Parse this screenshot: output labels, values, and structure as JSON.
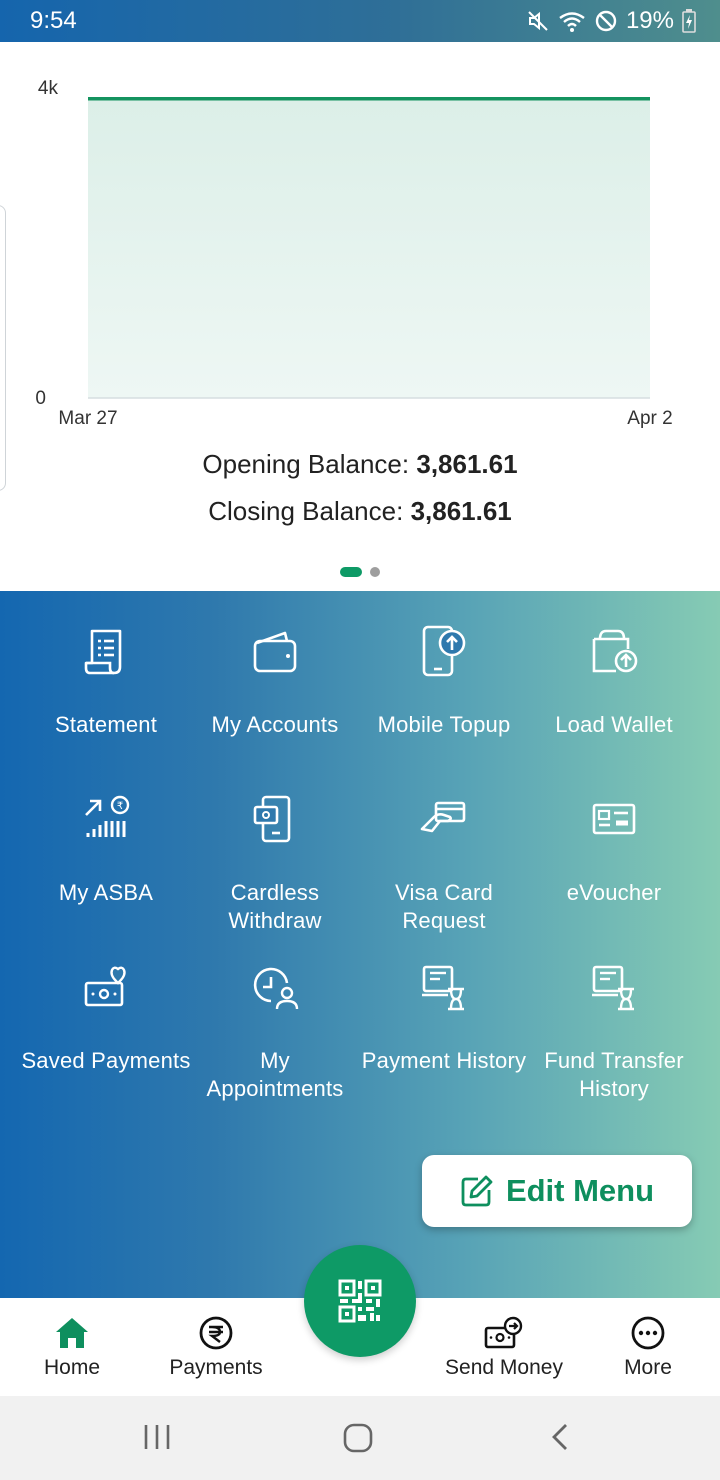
{
  "status_bar": {
    "time": "9:54",
    "battery": "19%"
  },
  "chart_data": {
    "type": "area",
    "x": [
      "Mar 27",
      "Apr 2"
    ],
    "y": [
      3861.61,
      3861.61
    ],
    "y_ticks": [
      "0",
      "4k"
    ],
    "ylim": [
      0,
      4000
    ],
    "color": "#14935f"
  },
  "balances": {
    "opening_label": "Opening Balance:",
    "opening_value": "3,861.61",
    "closing_label": "Closing Balance:",
    "closing_value": "3,861.61"
  },
  "menu": {
    "items": [
      {
        "label": "Statement",
        "icon": "statement-icon"
      },
      {
        "label": "My Accounts",
        "icon": "wallet-icon"
      },
      {
        "label": "Mobile Topup",
        "icon": "mobile-topup-icon"
      },
      {
        "label": "Load Wallet",
        "icon": "load-wallet-icon"
      },
      {
        "label": "My ASBA",
        "icon": "asba-icon"
      },
      {
        "label": "Cardless Withdraw",
        "icon": "cardless-withdraw-icon"
      },
      {
        "label": "Visa Card Request",
        "icon": "visa-card-icon"
      },
      {
        "label": "eVoucher",
        "icon": "evoucher-icon"
      },
      {
        "label": "Saved Payments",
        "icon": "saved-payments-icon"
      },
      {
        "label": "My Appointments",
        "icon": "appointment-icon"
      },
      {
        "label": "Payment History",
        "icon": "payment-history-icon"
      },
      {
        "label": "Fund Transfer History",
        "icon": "fund-transfer-history-icon"
      }
    ],
    "edit_label": "Edit Menu"
  },
  "bottom_nav": {
    "home": "Home",
    "payments": "Payments",
    "send_money": "Send Money",
    "more": "More"
  },
  "colors": {
    "brand_green": "#0e9a66",
    "gradient_start": "#1467b0",
    "gradient_end": "#86cbb4"
  }
}
